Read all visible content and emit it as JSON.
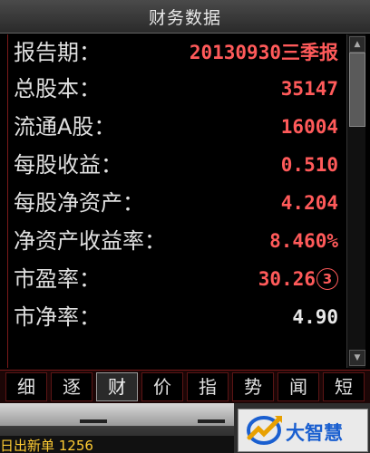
{
  "window": {
    "title": "财务数据"
  },
  "rows": [
    {
      "label": "报告期：",
      "value": "20130930三季报",
      "color": "#ff5a5a"
    },
    {
      "label": "总股本：",
      "value": "35147",
      "color": "#ff5a5a"
    },
    {
      "label": "流通A股：",
      "value": "16004",
      "color": "#ff5a5a"
    },
    {
      "label": "每股收益：",
      "value": "0.510",
      "color": "#ff5a5a"
    },
    {
      "label": "每股净资产：",
      "value": "4.204",
      "color": "#ff5a5a"
    },
    {
      "label": "净资产收益率：",
      "value": "8.460%",
      "color": "#ff5a5a"
    },
    {
      "label": "市盈率：",
      "value": "30.26",
      "badge": "3",
      "color": "#ff5a5a"
    },
    {
      "label": "市净率：",
      "value": "4.90",
      "color": "#e8e8e8"
    }
  ],
  "tabs": [
    {
      "label": "细",
      "active": false
    },
    {
      "label": "逐",
      "active": false
    },
    {
      "label": "财",
      "active": true
    },
    {
      "label": "价",
      "active": false
    },
    {
      "label": "指",
      "active": false
    },
    {
      "label": "势",
      "active": false
    },
    {
      "label": "闻",
      "active": false
    },
    {
      "label": "短",
      "active": false
    }
  ],
  "ticker": {
    "text": "日出新单 1256"
  },
  "logo": {
    "text": "大智慧"
  },
  "colors": {
    "value_red": "#ff5a5a",
    "label_white": "#e0e0e0",
    "border_red": "#7a1a1a",
    "logo_blue": "#1a5fd0",
    "ticker_yellow": "#ffcc33"
  }
}
